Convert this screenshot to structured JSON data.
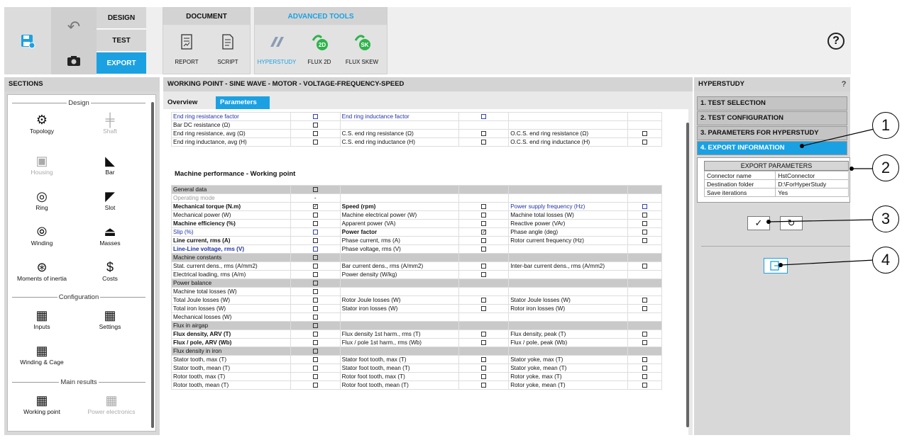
{
  "ribbon": {
    "modes": [
      "DESIGN",
      "TEST",
      "EXPORT"
    ],
    "document_group": "DOCUMENT",
    "advanced_group": "ADVANCED TOOLS",
    "tools": [
      "REPORT",
      "SCRIPT",
      "HYPERSTUDY",
      "FLUX 2D",
      "FLUX SKEW"
    ],
    "help": "?"
  },
  "sections": {
    "title": "SECTIONS",
    "design_label": "Design",
    "config_label": "Configuration",
    "results_label": "Main results",
    "items": [
      "Topology",
      "Shaft",
      "Housing",
      "Bar",
      "Ring",
      "Slot",
      "Winding",
      "Masses",
      "Moments of inertia",
      "Costs",
      "Inputs",
      "Settings",
      "Winding & Cage",
      "Working point",
      "Power electronics"
    ]
  },
  "main": {
    "title": "WORKING POINT - SINE WAVE - MOTOR - VOLTAGE-FREQUENCY-SPEED",
    "tabs": [
      "Overview",
      "Parameters"
    ],
    "section_title": "Machine performance - Working point"
  },
  "top_rows": [
    [
      "End ring resistance factor",
      "b",
      "End ring inductance factor",
      "b",
      "",
      ""
    ],
    [
      "Bar DC resistance (Ω)",
      "o",
      "",
      "",
      "",
      ""
    ],
    [
      "End ring resistance, avg (Ω)",
      "o",
      "C.S. end ring resistance (Ω)",
      "o",
      "O.C.S. end ring resistance (Ω)",
      "o"
    ],
    [
      "End ring inductance, avg (H)",
      "o",
      "C.S. end ring inductance (H)",
      "o",
      "O.C.S. end ring inductance (H)",
      "o"
    ]
  ],
  "rows": [
    {
      "h": 1,
      "c": [
        "General data",
        "o"
      ]
    },
    {
      "c": [
        "Operating mode",
        "-",
        "",
        "",
        "",
        ""
      ],
      "s": [
        "grey"
      ]
    },
    {
      "c": [
        "Mechanical torque (N.m)",
        "x",
        "Speed (rpm)",
        "o",
        "Power supply frequency (Hz)",
        "b"
      ],
      "s": [
        "bold",
        "bold",
        "blue"
      ]
    },
    {
      "c": [
        "Mechanical power (W)",
        "o",
        "Machine electrical power (W)",
        "o",
        "Machine total losses (W)",
        "o"
      ]
    },
    {
      "c": [
        "Machine efficiency (%)",
        "o",
        "Apparent power (VA)",
        "o",
        "Reactive power (VAr)",
        "o"
      ],
      "s": [
        "bold"
      ]
    },
    {
      "c": [
        "Slip (%)",
        "b",
        "Power factor",
        "x",
        "Phase angle (deg)",
        "o"
      ],
      "s": [
        "blue",
        "bold"
      ]
    },
    {
      "c": [
        "Line current, rms (A)",
        "o",
        "Phase current, rms (A)",
        "o",
        "Rotor current frequency (Hz)",
        "o"
      ],
      "s": [
        "bold"
      ]
    },
    {
      "c": [
        "Line-Line voltage, rms (V)",
        "b",
        "Phase voltage, rms (V)",
        "o",
        "",
        ""
      ],
      "s": [
        "blb"
      ]
    },
    {
      "h": 1,
      "c": [
        "Machine constants",
        "o"
      ]
    },
    {
      "c": [
        "Stat. current dens., rms (A/mm2)",
        "o",
        "Bar current dens., rms (A/mm2)",
        "o",
        "Inter-bar current dens., rms (A/mm2)",
        "o"
      ]
    },
    {
      "c": [
        "Electrical loading, rms (A/m)",
        "o",
        "Power density (W/kg)",
        "o",
        "",
        ""
      ]
    },
    {
      "h": 1,
      "c": [
        "Power balance",
        "o"
      ]
    },
    {
      "c": [
        "Machine total losses (W)",
        "o",
        "",
        "",
        "",
        ""
      ]
    },
    {
      "c": [
        "Total Joule losses (W)",
        "o",
        "Rotor Joule losses (W)",
        "o",
        "Stator Joule losses (W)",
        "o"
      ]
    },
    {
      "c": [
        "Total iron losses (W)",
        "o",
        "Stator iron losses (W)",
        "o",
        "Rotor iron losses (W)",
        "o"
      ]
    },
    {
      "c": [
        "Mechanical losses (W)",
        "o",
        "",
        "",
        "",
        ""
      ]
    },
    {
      "h": 1,
      "c": [
        "Flux in airgap",
        "o"
      ]
    },
    {
      "c": [
        "Flux density, ARV (T)",
        "o",
        "Flux density 1st harm., rms (T)",
        "o",
        "Flux density, peak (T)",
        "o"
      ],
      "s": [
        "bold"
      ]
    },
    {
      "c": [
        "Flux / pole, ARV (Wb)",
        "o",
        "Flux / pole 1st harm., rms (Wb)",
        "o",
        "Flux / pole, peak (Wb)",
        "o"
      ],
      "s": [
        "bold"
      ]
    },
    {
      "h": 1,
      "c": [
        "Flux density in iron",
        "o"
      ]
    },
    {
      "c": [
        "Stator tooth, max (T)",
        "o",
        "Stator foot tooth, max (T)",
        "o",
        "Stator yoke, max (T)",
        "o"
      ]
    },
    {
      "c": [
        "Stator tooth, mean (T)",
        "o",
        "Stator foot tooth, mean (T)",
        "o",
        "Stator yoke, mean (T)",
        "o"
      ]
    },
    {
      "c": [
        "Rotor tooth, max (T)",
        "o",
        "Rotor foot tooth, max (T)",
        "o",
        "Rotor yoke, max (T)",
        "o"
      ]
    },
    {
      "c": [
        "Rotor tooth, mean (T)",
        "o",
        "Rotor foot tooth, mean (T)",
        "o",
        "Rotor yoke, mean (T)",
        "o"
      ]
    }
  ],
  "hyperstudy": {
    "title": "HYPERSTUDY",
    "help": "?",
    "steps": [
      "1. TEST SELECTION",
      "2. TEST CONFIGURATION",
      "3. PARAMETERS FOR HYPERSTUDY",
      "4. EXPORT INFORMATION"
    ],
    "export_title": "EXPORT PARAMETERS",
    "params": [
      [
        "Connector name",
        "HstConnector"
      ],
      [
        "Destination folder",
        "D:\\ForHyperStudy"
      ],
      [
        "Save iterations",
        "Yes"
      ]
    ]
  },
  "callouts": [
    "1",
    "2",
    "3",
    "4"
  ],
  "colors": {
    "accent": "#1ba1e2",
    "link": "#2233aa"
  }
}
